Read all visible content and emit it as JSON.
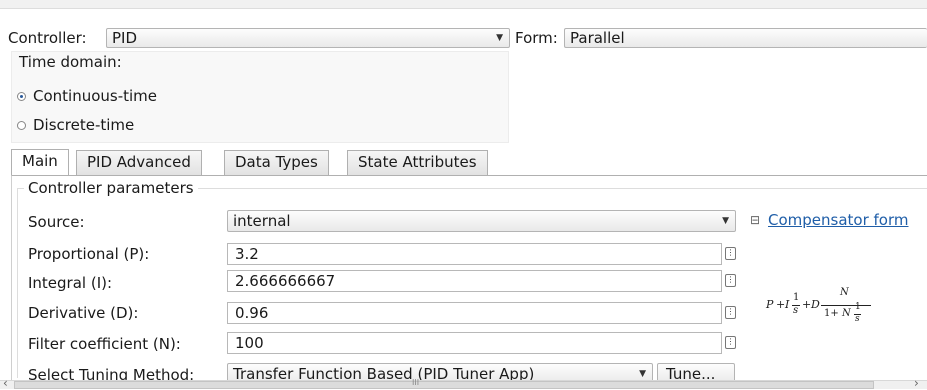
{
  "header": {
    "controller_label": "Controller:",
    "controller_value": "PID",
    "form_label": "Form:",
    "form_value": "Parallel"
  },
  "time_domain": {
    "title": "Time domain:",
    "options": [
      "Continuous-time",
      "Discrete-time"
    ],
    "selected": "Continuous-time"
  },
  "tabs": [
    {
      "label": "Main",
      "active": true
    },
    {
      "label": "PID Advanced",
      "active": false
    },
    {
      "label": "Data Types",
      "active": false
    },
    {
      "label": "State Attributes",
      "active": false
    }
  ],
  "parameters": {
    "group_title": "Controller parameters",
    "source": {
      "label": "Source:",
      "value": "internal"
    },
    "proportional": {
      "label": "Proportional (P):",
      "value": "3.2"
    },
    "integral": {
      "label": "Integral (I):",
      "value": "2.666666667"
    },
    "derivative": {
      "label": "Derivative (D):",
      "value": "0.96"
    },
    "filter": {
      "label": "Filter coefficient (N):",
      "value": "100"
    },
    "tuning": {
      "label": "Select Tuning Method:",
      "value": "Transfer Function Based (PID Tuner App)",
      "button": "Tune..."
    }
  },
  "compensator": {
    "toggle": "⊟",
    "link": "Compensator form",
    "formula": {
      "p": "P",
      "plus1": "+",
      "i": "I",
      "one": "1",
      "s": "s",
      "plus2": "+",
      "d": "D",
      "n_num": "N",
      "denom_prefix": "1+",
      "n_denom": "N",
      "one2": "1",
      "s2": "s"
    }
  },
  "scrollbar": {
    "thumb_mark": "III",
    "left_arrow": "‹",
    "right_arrow": "›"
  }
}
